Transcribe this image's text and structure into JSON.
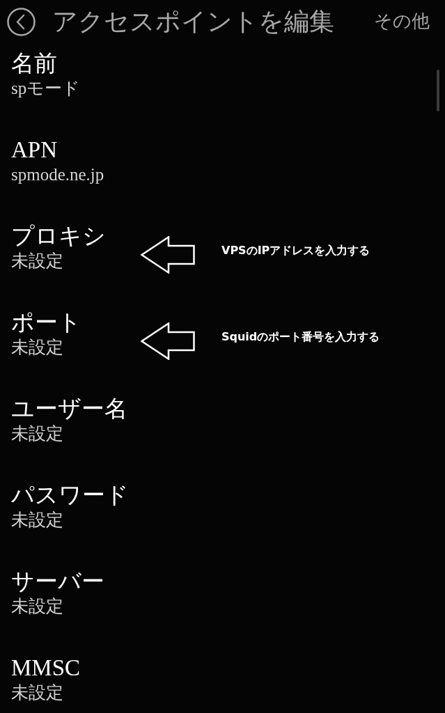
{
  "header": {
    "title": "アクセスポイントを編集",
    "menu": "その他"
  },
  "settings": [
    {
      "title": "名前",
      "value": "spモード"
    },
    {
      "title": "APN",
      "value": "spmode.ne.jp"
    },
    {
      "title": "プロキシ",
      "value": "未設定",
      "annotation": "VPSのIPアドレスを入力する"
    },
    {
      "title": "ポート",
      "value": "未設定",
      "annotation": "Squidのポート番号を入力する"
    },
    {
      "title": "ユーザー名",
      "value": "未設定"
    },
    {
      "title": "パスワード",
      "value": "未設定"
    },
    {
      "title": "サーバー",
      "value": "未設定"
    },
    {
      "title": "MMSC",
      "value": "未設定"
    }
  ]
}
